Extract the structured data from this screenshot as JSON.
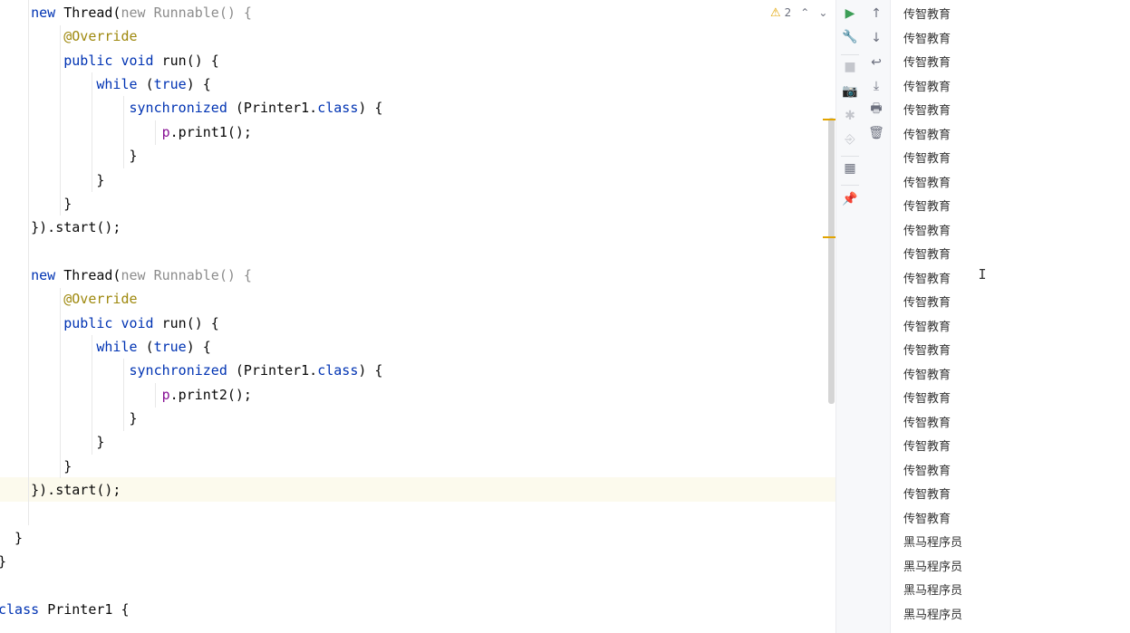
{
  "editor": {
    "lines": [
      [
        {
          "t": "    "
        },
        {
          "t": "new ",
          "c": "kw"
        },
        {
          "t": "Thread("
        },
        {
          "t": "new ",
          "c": "gr"
        },
        {
          "t": "Runnable() {",
          "c": "gr"
        }
      ],
      [
        {
          "t": "        "
        },
        {
          "t": "@Override",
          "c": "ann"
        }
      ],
      [
        {
          "t": "        "
        },
        {
          "t": "public void ",
          "c": "kw"
        },
        {
          "t": "run() {"
        }
      ],
      [
        {
          "t": "            "
        },
        {
          "t": "while ",
          "c": "kw"
        },
        {
          "t": "("
        },
        {
          "t": "true",
          "c": "kw"
        },
        {
          "t": ") {"
        }
      ],
      [
        {
          "t": "                "
        },
        {
          "t": "synchronized ",
          "c": "kw"
        },
        {
          "t": "(Printer1."
        },
        {
          "t": "class",
          "c": "kw"
        },
        {
          "t": ") {"
        }
      ],
      [
        {
          "t": "                    "
        },
        {
          "t": "p",
          "c": "fld"
        },
        {
          "t": ".print1();"
        }
      ],
      [
        {
          "t": "                }"
        }
      ],
      [
        {
          "t": "            }"
        }
      ],
      [
        {
          "t": "        }"
        }
      ],
      [
        {
          "t": "    }).start();"
        }
      ],
      [],
      [
        {
          "t": "    "
        },
        {
          "t": "new ",
          "c": "kw"
        },
        {
          "t": "Thread("
        },
        {
          "t": "new ",
          "c": "gr"
        },
        {
          "t": "Runnable() {",
          "c": "gr"
        }
      ],
      [
        {
          "t": "        "
        },
        {
          "t": "@Override",
          "c": "ann"
        }
      ],
      [
        {
          "t": "        "
        },
        {
          "t": "public void ",
          "c": "kw"
        },
        {
          "t": "run() {"
        }
      ],
      [
        {
          "t": "            "
        },
        {
          "t": "while ",
          "c": "kw"
        },
        {
          "t": "("
        },
        {
          "t": "true",
          "c": "kw"
        },
        {
          "t": ") {"
        }
      ],
      [
        {
          "t": "                "
        },
        {
          "t": "synchronized ",
          "c": "kw"
        },
        {
          "t": "(Printer1."
        },
        {
          "t": "class",
          "c": "kw"
        },
        {
          "t": ") {"
        }
      ],
      [
        {
          "t": "                    "
        },
        {
          "t": "p",
          "c": "fld"
        },
        {
          "t": ".print2();"
        }
      ],
      [
        {
          "t": "                }"
        }
      ],
      [
        {
          "t": "            }"
        }
      ],
      [
        {
          "t": "        }"
        }
      ],
      [
        {
          "t": "    }).start();"
        }
      ],
      [],
      [
        {
          "t": "  }"
        }
      ],
      [
        {
          "t": "}"
        }
      ],
      [],
      [
        {
          "t": "class ",
          "c": "kw"
        },
        {
          "t": "Printer1 {"
        }
      ]
    ]
  },
  "inspection": {
    "warning_count": "2",
    "warning_icon": "⚠",
    "prev_icon": "⌃",
    "next_icon": "⌄"
  },
  "toolbar_left": [
    {
      "name": "rerun-icon",
      "glyph": "▶",
      "state": "run"
    },
    {
      "name": "wrench-icon",
      "glyph": "🔧",
      "state": "normal"
    },
    {
      "name": "stop-icon",
      "glyph": "■",
      "state": "disabled"
    },
    {
      "name": "camera-icon",
      "glyph": "📷",
      "state": "disabled"
    },
    {
      "name": "debug-icon",
      "glyph": "✱",
      "state": "disabled"
    },
    {
      "name": "exit-icon",
      "glyph": "⎆",
      "state": "disabled"
    },
    {
      "name": "layout-icon",
      "glyph": "▦",
      "state": "normal"
    },
    {
      "name": "pin-icon",
      "glyph": "📌",
      "state": "normal"
    }
  ],
  "toolbar_right": [
    {
      "name": "scroll-up-icon",
      "glyph": "↑"
    },
    {
      "name": "scroll-down-icon",
      "glyph": "↓"
    },
    {
      "name": "soft-wrap-icon",
      "glyph": "↩"
    },
    {
      "name": "scroll-to-end-icon",
      "glyph": "⤓"
    },
    {
      "name": "print-icon",
      "glyph": "🖶"
    },
    {
      "name": "clear-icon",
      "glyph": "🗑"
    }
  ],
  "console": {
    "lines": [
      "传智教育",
      "传智教育",
      "传智教育",
      "传智教育",
      "传智教育",
      "传智教育",
      "传智教育",
      "传智教育",
      "传智教育",
      "传智教育",
      "传智教育",
      "传智教育",
      "传智教育",
      "传智教育",
      "传智教育",
      "传智教育",
      "传智教育",
      "传智教育",
      "传智教育",
      "传智教育",
      "传智教育",
      "传智教育",
      "黑马程序员",
      "黑马程序员",
      "黑马程序员",
      "黑马程序员"
    ]
  },
  "colors": {
    "keyword": "#0033b3",
    "annotation": "#9e880d",
    "field": "#871094",
    "warning": "#e2a400",
    "run": "#3d9e57"
  }
}
